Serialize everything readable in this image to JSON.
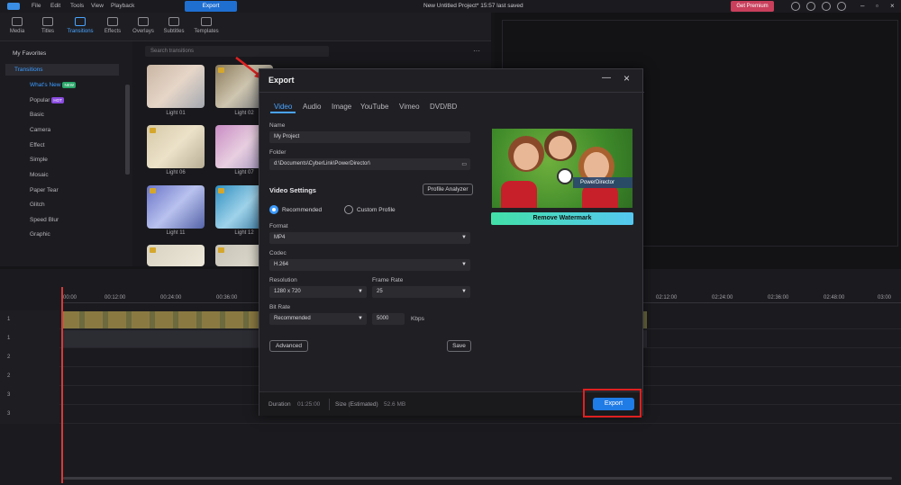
{
  "menubar": {
    "items": [
      "File",
      "Edit",
      "Tools",
      "View",
      "Playback"
    ],
    "export_label": "Export",
    "project_title": "New Untitled Project* 15:57 last saved",
    "premium_label": "Get Premium"
  },
  "media_tabs": [
    "Media",
    "Titles",
    "Transitions",
    "Effects",
    "Overlays",
    "Subtitles",
    "Templates"
  ],
  "sidebar": {
    "favorites": "My Favorites",
    "transitions": "Transitions",
    "items": [
      {
        "label": "What's New",
        "badge": "NEW",
        "badge_color": "#2aa86a"
      },
      {
        "label": "Popular",
        "badge": "HOT",
        "badge_color": "#8a4be0"
      },
      {
        "label": "Basic"
      },
      {
        "label": "Camera"
      },
      {
        "label": "Effect"
      },
      {
        "label": "Simple"
      },
      {
        "label": "Mosaic"
      },
      {
        "label": "Paper Tear"
      },
      {
        "label": "Glitch"
      },
      {
        "label": "Speed Blur"
      },
      {
        "label": "Graphic"
      }
    ]
  },
  "library": {
    "search_placeholder": "Search transitions",
    "thumbs": [
      "Light 01",
      "Light 02",
      "Light 06",
      "Light 07",
      "Light 11",
      "Light 12"
    ]
  },
  "timeline": {
    "times": [
      "00:00",
      "00:12:00",
      "00:24:00",
      "00:36:00",
      "02:12:00",
      "02:24:00",
      "02:36:00",
      "02:48:00",
      "03:00"
    ],
    "tracks": [
      "1",
      "1",
      "2",
      "2",
      "3",
      "3"
    ]
  },
  "dialog": {
    "title": "Export",
    "tabs": [
      "Video",
      "Audio",
      "Image",
      "YouTube",
      "Vimeo",
      "DVD/BD"
    ],
    "name_label": "Name",
    "name_value": "My Project",
    "folder_label": "Folder",
    "folder_value": "d:\\Documents\\CyberLink\\PowerDirector\\",
    "video_settings": "Video Settings",
    "profile_analyzer": "Profile Analyzer",
    "recommended": "Recommended",
    "custom_profile": "Custom Profile",
    "format_label": "Format",
    "format_value": "MP4",
    "codec_label": "Codec",
    "codec_value": "H.264",
    "resolution_label": "Resolution",
    "resolution_value": "1280 x 720",
    "framerate_label": "Frame Rate",
    "framerate_value": "25",
    "bitrate_label": "Bit Rate",
    "bitrate_value": "Recommended",
    "bitrate_number": "5000",
    "bitrate_unit": "Kbps",
    "advanced": "Advanced",
    "save": "Save",
    "watermark": "PowerDirector",
    "remove_watermark": "Remove Watermark",
    "duration_label": "Duration",
    "duration_value": "01:25:00",
    "size_label": "Size (Estimated)",
    "size_value": "52.6 MB",
    "export_button": "Export"
  },
  "colors": {
    "accent": "#3d9bff",
    "export_blue": "#1f7be6",
    "highlight_red": "#e02020",
    "premium": "#c93f5c"
  }
}
